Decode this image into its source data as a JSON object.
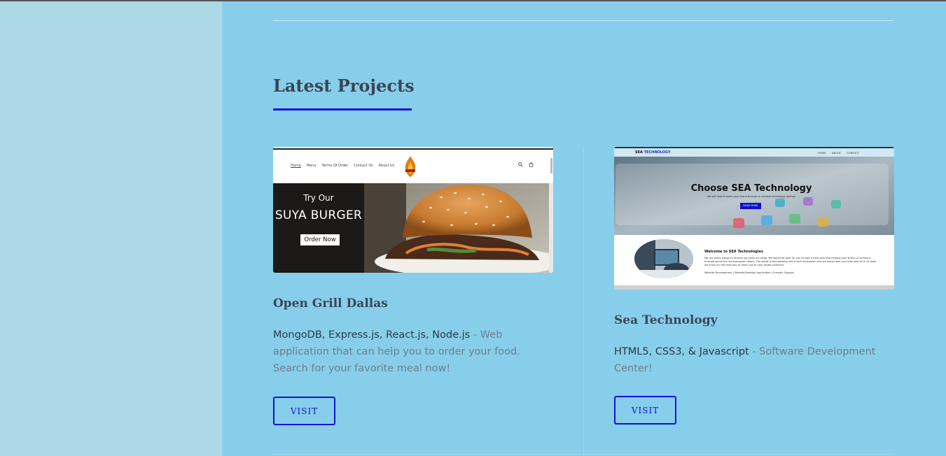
{
  "section": {
    "title": "Latest Projects"
  },
  "colors": {
    "page_bg": "#87ceeb",
    "left_panel_bg": "#add8e6",
    "accent": "#1010dd",
    "heading": "#3a4652"
  },
  "projects": [
    {
      "title": "Open Grill Dallas",
      "tech": "MongoDB, Express.js, React.js, Node.js",
      "description": " - Web application that can help you to order your food. Search for your favorite meal now!",
      "button_label": "VISIT",
      "thumbnail": {
        "nav_links": [
          "Home",
          "Menu",
          "Terms Of Order",
          "Contact Us",
          "About Us"
        ],
        "banner_line1": "Try Our",
        "banner_line2": "SUYA BURGER",
        "banner_button": "Order Now",
        "icons": [
          "search-icon",
          "cart-icon"
        ]
      }
    },
    {
      "title": "Sea Technology",
      "tech": "HTML5, CSS3, & Javascript",
      "description": " - Software Development Center!",
      "button_label": "VISIT",
      "thumbnail": {
        "brand_part1": "SEA ",
        "brand_part2": "TECHNOLOGY",
        "nav_links": [
          "HOME",
          "ABOUT",
          "CONTACT"
        ],
        "hero_title": "Choose SEA Technology",
        "hero_subtitle": "We will help to make your brand through or achieve technology journey",
        "hero_button": "READ MORE",
        "welcome_title": "Welcome to SEA Technologies",
        "welcome_body": "We are really happy to receive you onto our page. We would be glad for you to take a bold step into helping your brand or company through some fine technological means. The world is fast growing into a tech ecosystem and we would love you to be part of it. At least we know it's the best way to reach out to your target audience.",
        "services": "Website Development | Website/Desktop Application | Friendly Support"
      }
    }
  ]
}
